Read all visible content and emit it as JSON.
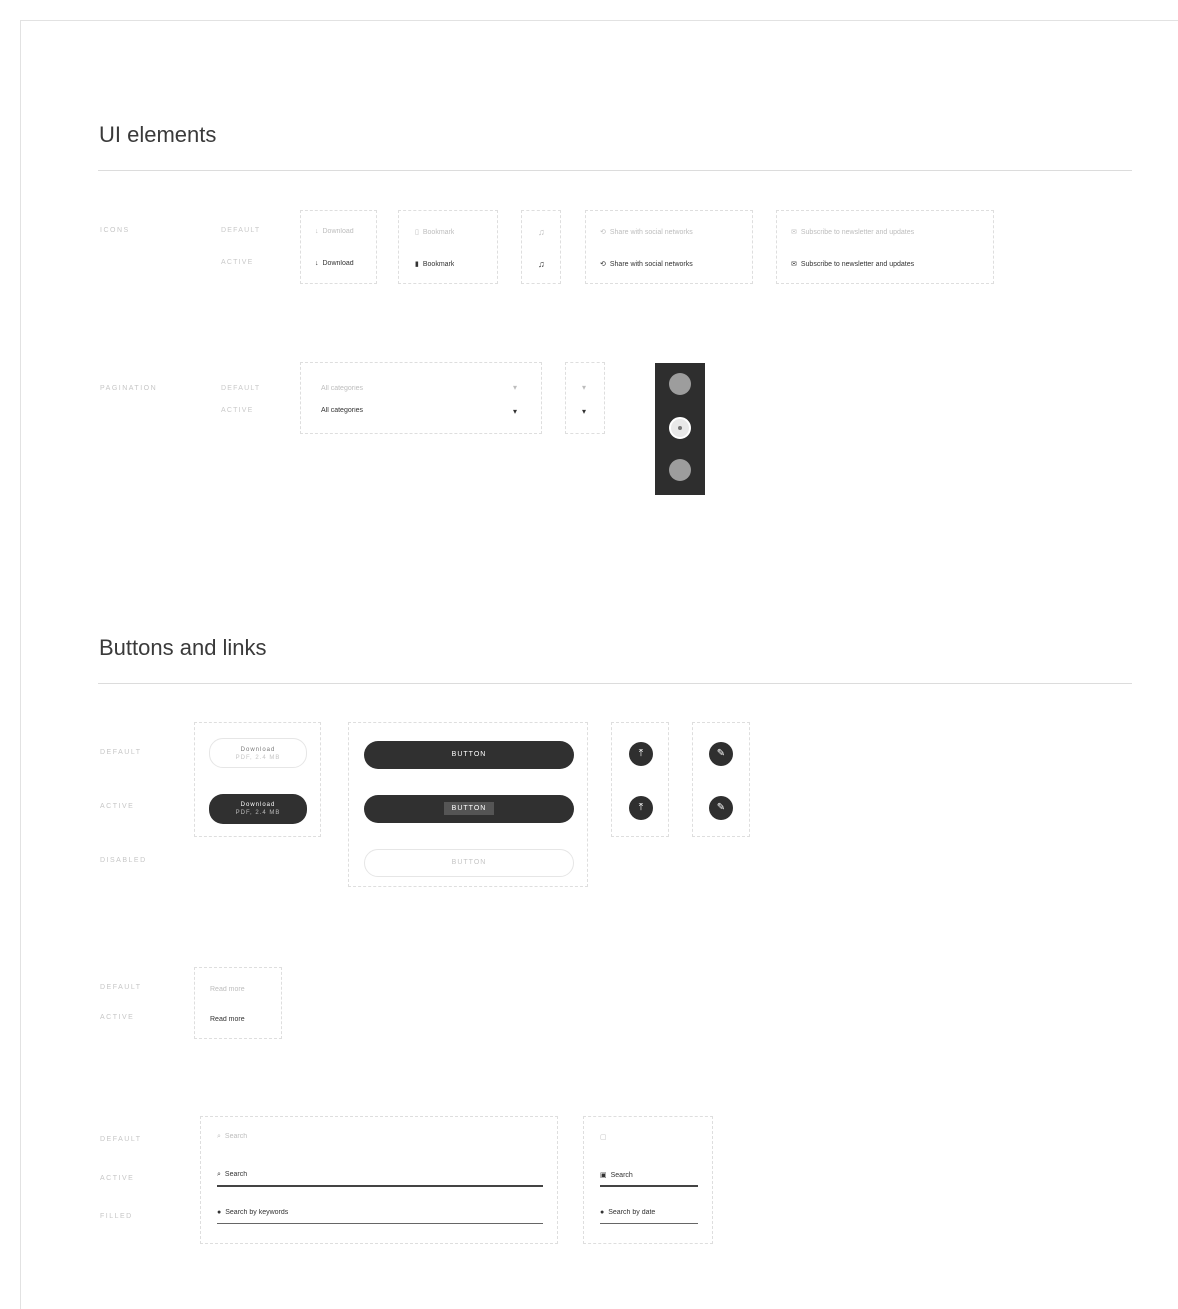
{
  "sections": {
    "ui_elements": {
      "title": "UI elements"
    },
    "buttons_links": {
      "title": "Buttons and links"
    }
  },
  "ui": {
    "icons_row": {
      "label": "ICONS",
      "states": [
        "DEFAULT",
        "ACTIVE"
      ],
      "items": [
        {
          "default": "Download",
          "active": "Download"
        },
        {
          "default": "Bookmark",
          "active": "Bookmark"
        },
        {
          "default": "",
          "active": ""
        },
        {
          "default": "Share with social networks",
          "active": "Share with social networks"
        },
        {
          "default": "Subscribe to newsletter and updates",
          "active": "Subscribe to newsletter and updates"
        }
      ]
    },
    "pagination_row": {
      "label": "PAGINATION",
      "states": [
        "DEFAULT",
        "ACTIVE"
      ],
      "dropdown": {
        "default": "All categories",
        "active": "All categories"
      }
    }
  },
  "buttons": {
    "states": [
      "DEFAULT",
      "ACTIVE",
      "DISABLED"
    ],
    "small_button": {
      "default_line1": "Download",
      "default_line2": "PDF, 2.4 MB",
      "active_line1": "Download",
      "active_line2": "PDF, 2.4 MB"
    },
    "large_button": {
      "default": "BUTTON",
      "active": "BUTTON",
      "disabled": "BUTTON"
    }
  },
  "links": {
    "states": [
      "DEFAULT",
      "ACTIVE"
    ],
    "default": "Read more",
    "active": "Read more"
  },
  "inputs": {
    "states": [
      "DEFAULT",
      "ACTIVE",
      "FILLED"
    ],
    "wide": {
      "default": "Search",
      "active": "Search",
      "filled": "Search by keywords"
    },
    "narrow": {
      "default": "",
      "active": "Search",
      "filled": "Search by date"
    }
  }
}
